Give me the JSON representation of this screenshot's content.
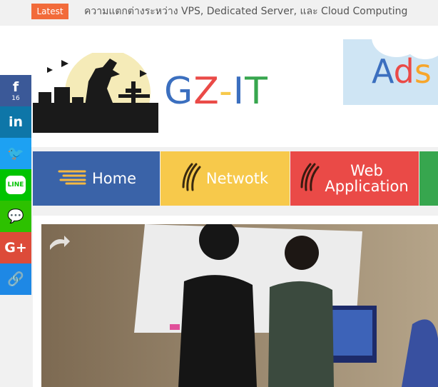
{
  "ticker": {
    "label": "Latest",
    "headline": "ความแตกต่างระหว่าง VPS, Dedicated Server, และ Cloud Computing"
  },
  "logo": {
    "letters": [
      {
        "char": "G",
        "color": "#3b6fbf"
      },
      {
        "char": "Z",
        "color": "#ea4a47"
      },
      {
        "char": "-",
        "color": "#f7c94b"
      },
      {
        "char": "I",
        "color": "#3b6fbf"
      },
      {
        "char": "T",
        "color": "#37a64e"
      }
    ]
  },
  "ad": {
    "letters": [
      {
        "char": "A",
        "color": "#3b6fbf"
      },
      {
        "char": "d",
        "color": "#ea4a47"
      },
      {
        "char": "s",
        "color": "#f7a62b"
      }
    ]
  },
  "nav": {
    "home": "Home",
    "network": "Netwotk",
    "web_line1": "Web",
    "web_line2": "Application"
  },
  "social": [
    {
      "icon": "facebook-icon",
      "glyph": "f",
      "color": "#3b5998",
      "count": "16"
    },
    {
      "icon": "linkedin-icon",
      "glyph": "in",
      "color": "#0e76a8",
      "count": ""
    },
    {
      "icon": "twitter-icon",
      "glyph": "🐦",
      "color": "#1da1f2",
      "count": ""
    },
    {
      "icon": "line-icon",
      "glyph": "LINE",
      "color": "#00c300",
      "count": ""
    },
    {
      "icon": "wechat-icon",
      "glyph": "💬",
      "color": "#2dc100",
      "count": ""
    },
    {
      "icon": "google-plus-icon",
      "glyph": "G+",
      "color": "#dd4b39",
      "count": ""
    },
    {
      "icon": "link-icon",
      "glyph": "🔗",
      "color": "#1e88e5",
      "count": ""
    }
  ]
}
